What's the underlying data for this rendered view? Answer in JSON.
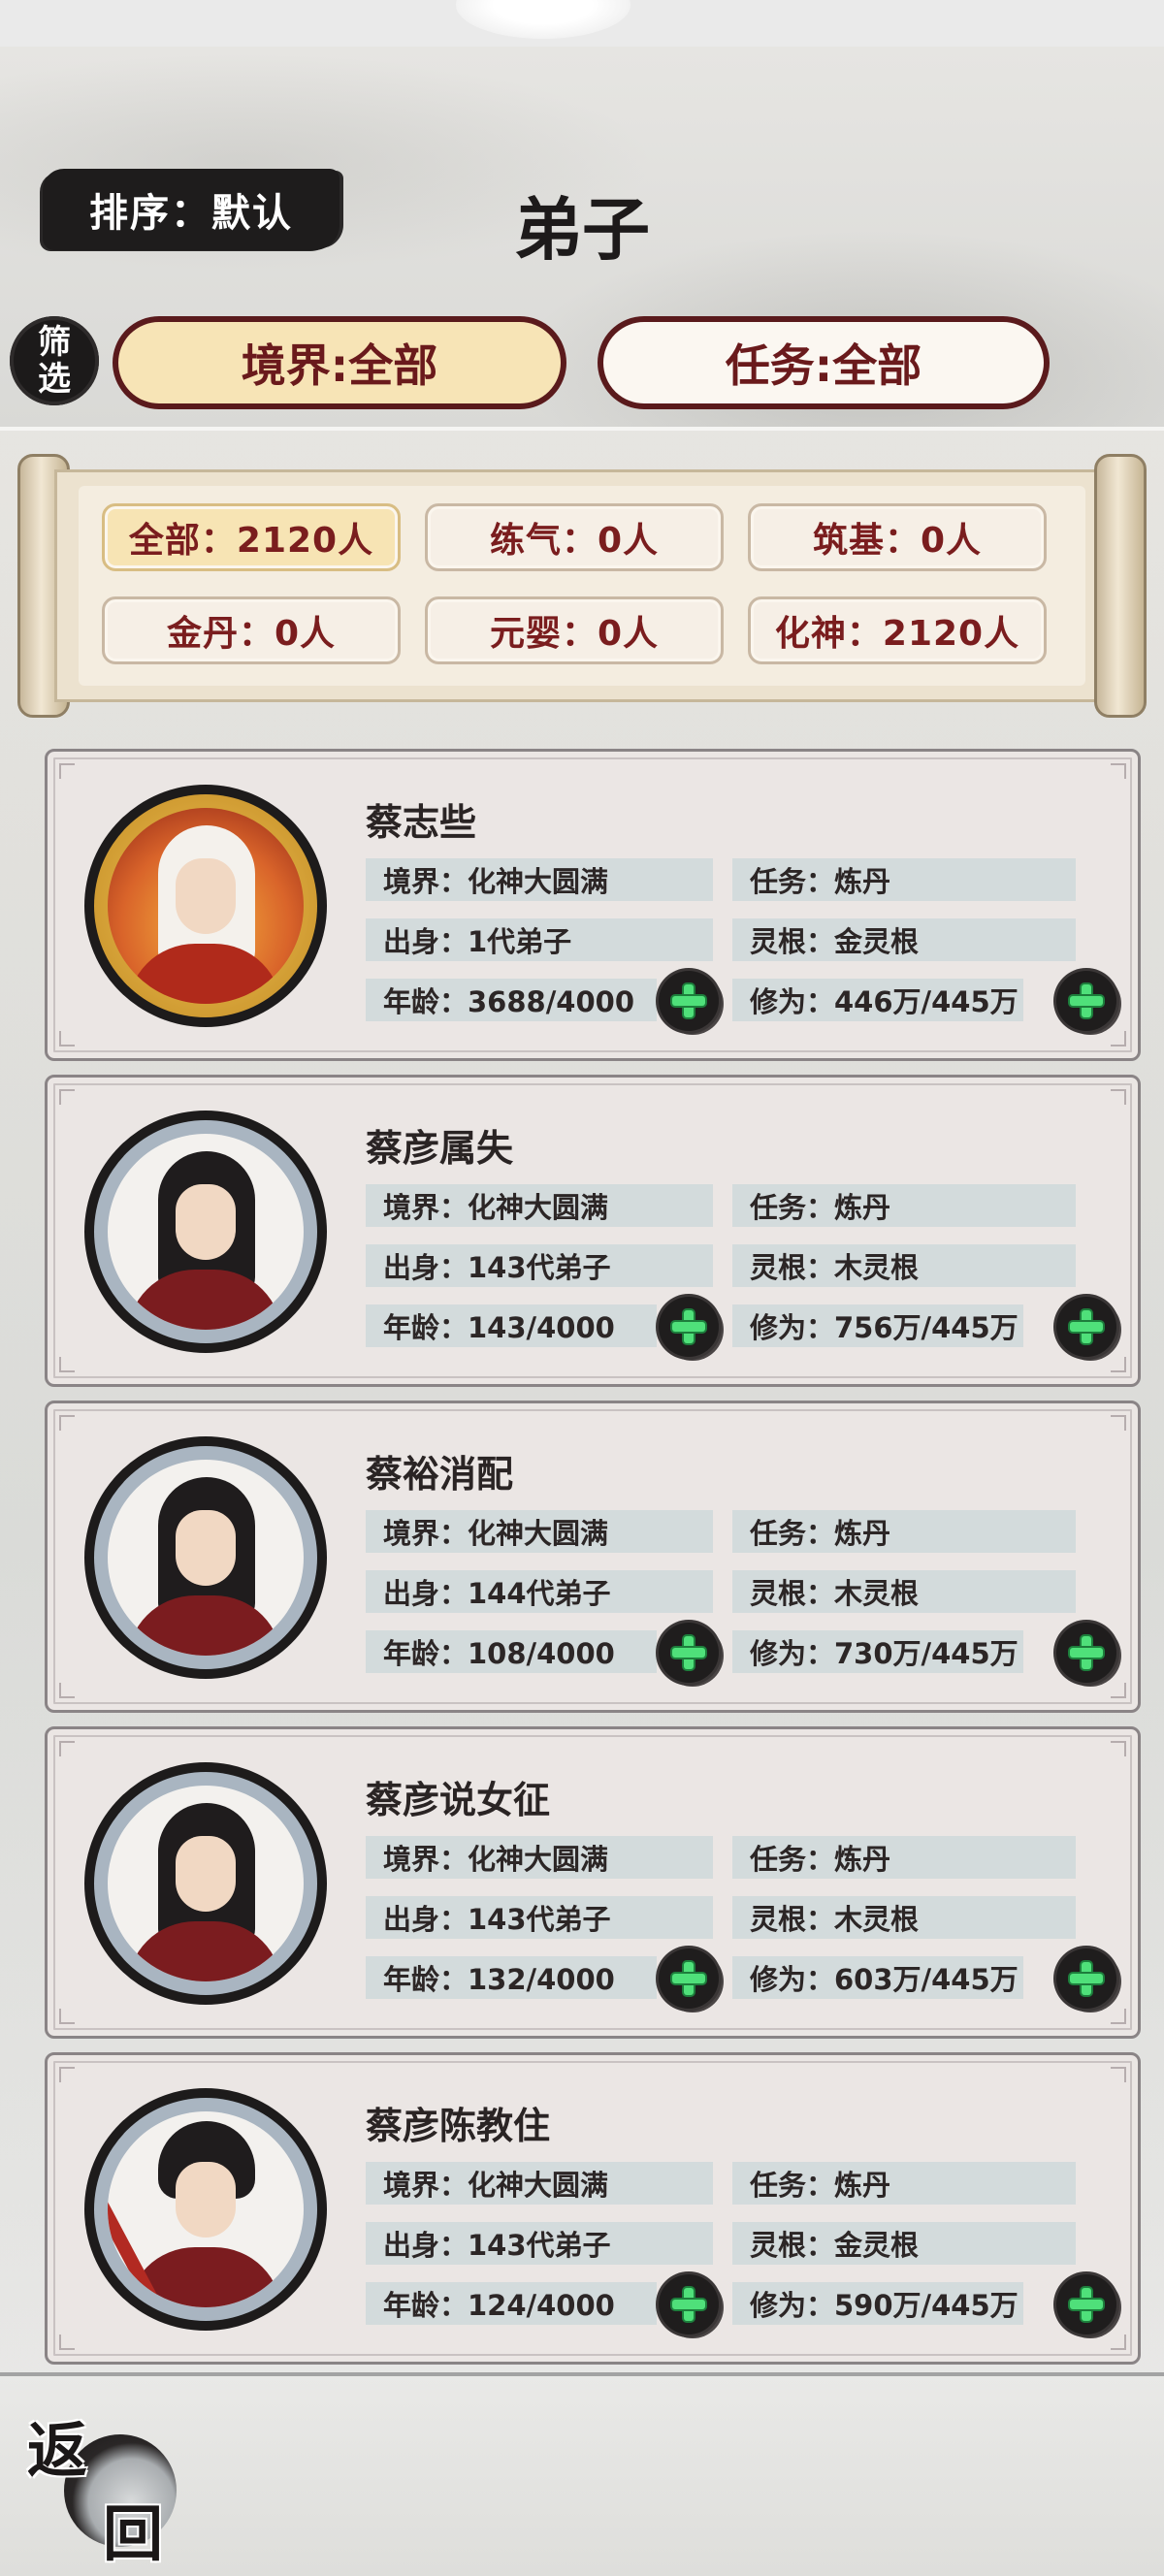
{
  "header": {
    "sort_label": "排序：默认",
    "title": "弟子",
    "filter_label": "筛选",
    "realm_filter": "境界:全部",
    "task_filter": "任务:全部"
  },
  "tallies": [
    {
      "label": "全部：2120人",
      "active": true
    },
    {
      "label": "练气：0人",
      "active": false
    },
    {
      "label": "筑基：0人",
      "active": false
    },
    {
      "label": "金丹：0人",
      "active": false
    },
    {
      "label": "元婴：0人",
      "active": false
    },
    {
      "label": "化神：2120人",
      "active": false
    }
  ],
  "disciples": [
    {
      "name": "蔡志些",
      "realm": "境界：化神大圆满",
      "task": "任务：炼丹",
      "origin": "出身：1代弟子",
      "root": "灵根：金灵根",
      "age": "年龄：3688/4000",
      "cultivation": "修为：446万/445万",
      "avatar": "fire-elder-avatar"
    },
    {
      "name": "蔡彦属失",
      "realm": "境界：化神大圆满",
      "task": "任务：炼丹",
      "origin": "出身：143代弟子",
      "root": "灵根：木灵根",
      "age": "年龄：143/4000",
      "cultivation": "修为：756万/445万",
      "avatar": "disciple-avatar"
    },
    {
      "name": "蔡裕消配",
      "realm": "境界：化神大圆满",
      "task": "任务：炼丹",
      "origin": "出身：144代弟子",
      "root": "灵根：木灵根",
      "age": "年龄：108/4000",
      "cultivation": "修为：730万/445万",
      "avatar": "disciple-avatar"
    },
    {
      "name": "蔡彦说女征",
      "realm": "境界：化神大圆满",
      "task": "任务：炼丹",
      "origin": "出身：143代弟子",
      "root": "灵根：木灵根",
      "age": "年龄：132/4000",
      "cultivation": "修为：603万/445万",
      "avatar": "disciple-avatar"
    },
    {
      "name": "蔡彦陈教住",
      "realm": "境界：化神大圆满",
      "task": "任务：炼丹",
      "origin": "出身：143代弟子",
      "root": "灵根：金灵根",
      "age": "年龄：124/4000",
      "cultivation": "修为：590万/445万",
      "avatar": "swordsman-avatar"
    }
  ],
  "footer": {
    "back_label_top": "返",
    "back_label_bottom": "回"
  },
  "colors": {
    "accent_red": "#6a1a1c",
    "pill_gold": "#f7e4b6",
    "plus_green": "#4fe07a"
  }
}
